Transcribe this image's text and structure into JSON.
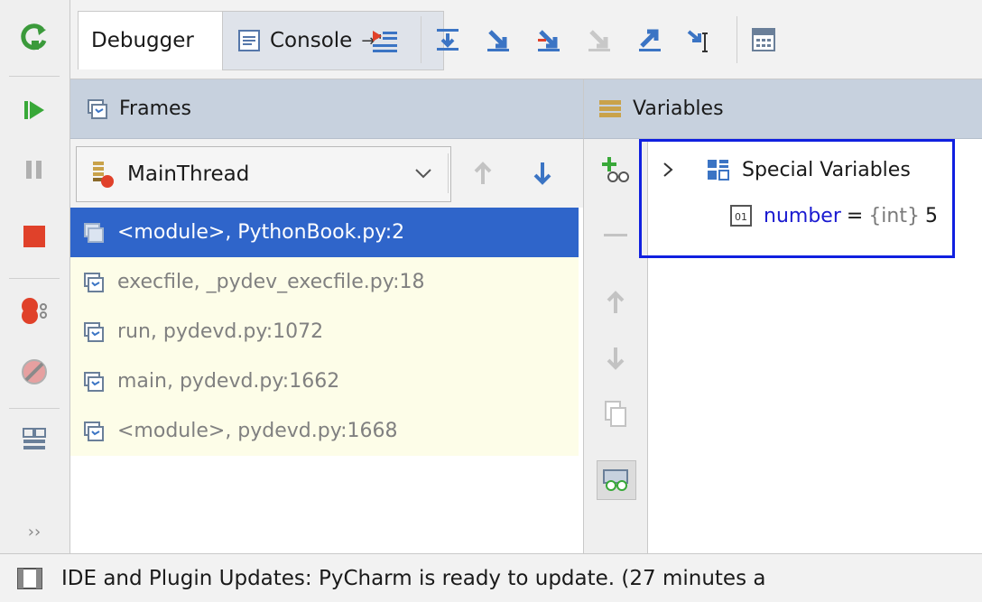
{
  "tabs": {
    "debugger_label": "Debugger",
    "console_label": "Console",
    "console_pin": "→\""
  },
  "frames": {
    "title": "Frames",
    "thread": "MainThread",
    "rows": [
      {
        "label": "<module>, PythonBook.py:2"
      },
      {
        "label": "execfile, _pydev_execfile.py:18"
      },
      {
        "label": "run, pydevd.py:1072"
      },
      {
        "label": "main, pydevd.py:1662"
      },
      {
        "label": "<module>, pydevd.py:1668"
      }
    ]
  },
  "variables": {
    "title": "Variables",
    "special": "Special Variables",
    "var_name": "number",
    "var_eq": "=",
    "var_type": "{int}",
    "var_value": "5"
  },
  "left_more": "››",
  "status": {
    "message": "IDE and Plugin Updates: PyCharm is ready to update. (27 minutes a"
  },
  "colors": {
    "selection": "#2f65ca",
    "header": "#c7d1de",
    "library_row": "#fdfde8",
    "highlight_border": "#1020e0"
  }
}
